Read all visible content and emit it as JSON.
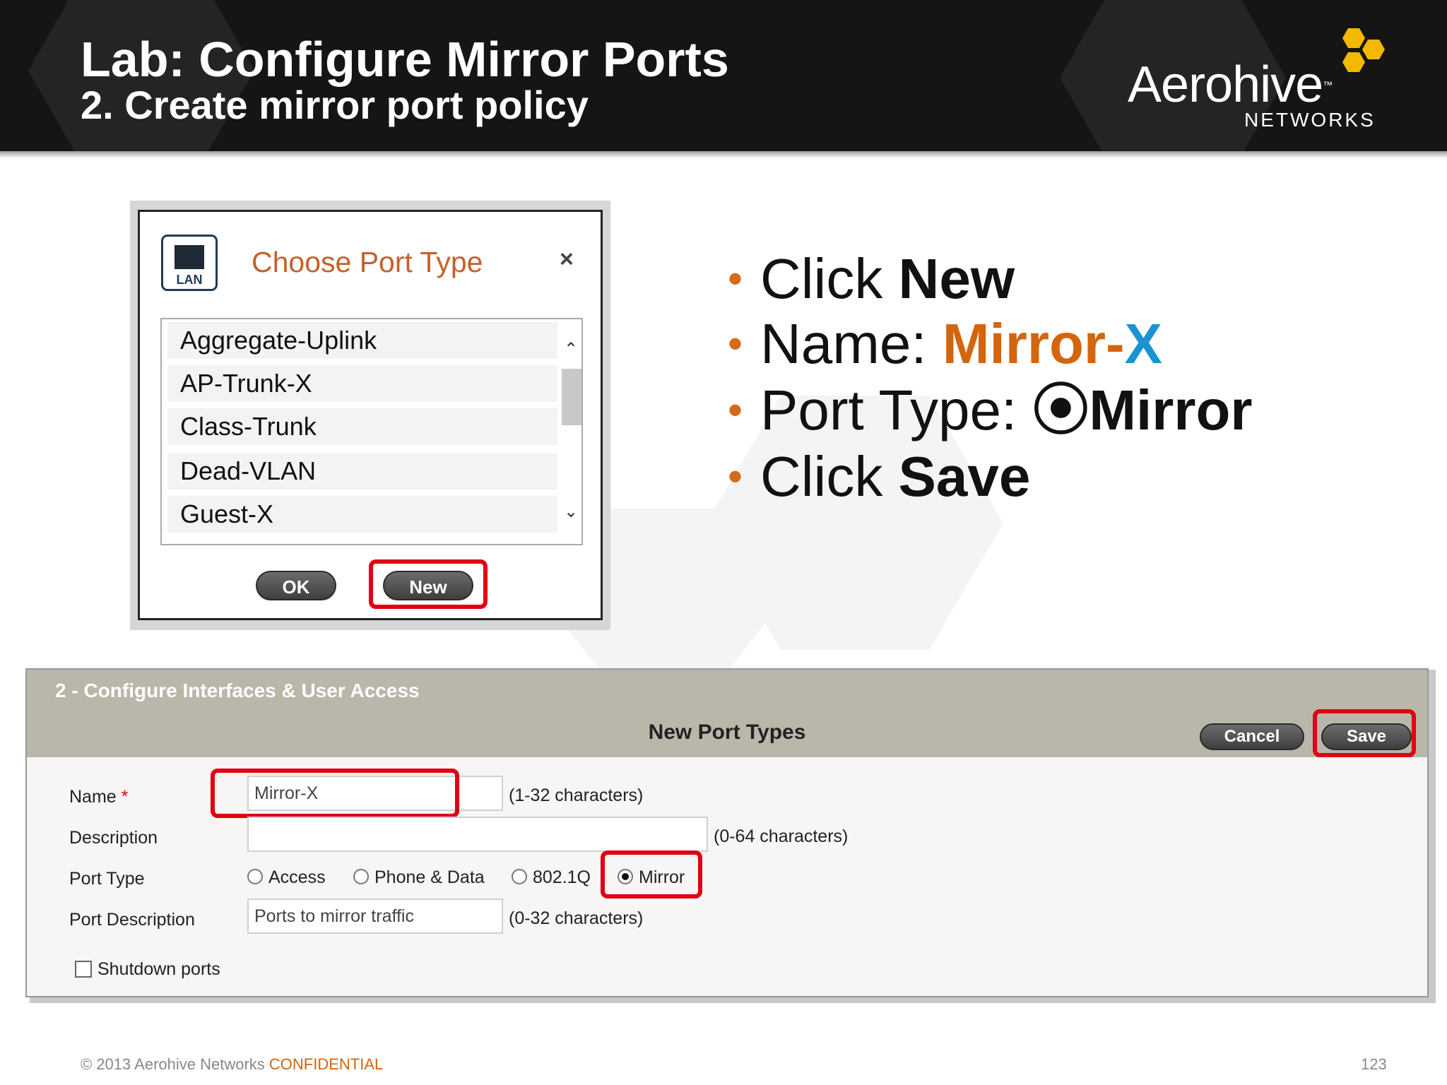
{
  "slide": {
    "title": "Lab: Configure Mirror Ports",
    "subtitle": "2. Create mirror port policy",
    "logo_main": "Aerohive",
    "logo_tm": "™",
    "logo_sub": "NETWORKS"
  },
  "dialog": {
    "icon_label": "LAN",
    "title": "Choose Port Type",
    "close_glyph": "×",
    "items": [
      "Aggregate-Uplink",
      "AP-Trunk-X",
      "Class-Trunk",
      "Dead-VLAN",
      "Guest-X"
    ],
    "ok_label": "OK",
    "new_label": "New"
  },
  "instructions": {
    "step1_verb": "Click ",
    "step1_target": "New",
    "step2_label": "Name: ",
    "step2_value_a": "Mirror-",
    "step2_value_b": "X",
    "step3_label": "Port Type: ",
    "step3_glyph": "⦿",
    "step3_value": "Mirror",
    "step4_verb": "Click ",
    "step4_target": "Save"
  },
  "form": {
    "step_title": "2 - Configure Interfaces & User Access",
    "title": "New Port Types",
    "cancel_label": "Cancel",
    "save_label": "Save",
    "name_label": "Name",
    "name_required": "*",
    "name_value": "Mirror-X",
    "name_hint": "(1-32 characters)",
    "description_label": "Description",
    "description_value": "",
    "description_hint": "(0-64 characters)",
    "port_type_label": "Port Type",
    "port_type_options": [
      "Access",
      "Phone & Data",
      "802.1Q",
      "Mirror"
    ],
    "port_type_selected": "Mirror",
    "port_description_label": "Port Description",
    "port_description_value": "Ports to mirror traffic",
    "port_description_hint": "(0-32 characters)",
    "shutdown_label": "Shutdown ports",
    "shutdown_checked": false
  },
  "footer": {
    "copyright": "© 2013 Aerohive Networks ",
    "confidential": "CONFIDENTIAL",
    "page_number": "123"
  },
  "colors": {
    "accent_orange": "#d4650f",
    "accent_blue": "#1b93d1",
    "highlight_red": "#e00012",
    "header_bg": "#151515",
    "logo_yellow": "#f5b800"
  }
}
